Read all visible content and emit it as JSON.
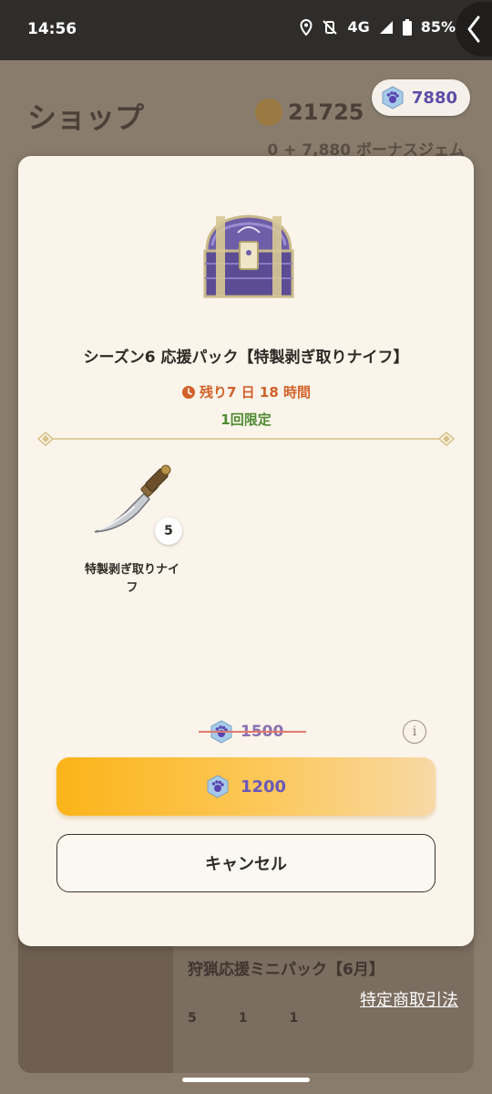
{
  "status_bar": {
    "time": "14:56",
    "network": "4G",
    "battery": "85%"
  },
  "shop": {
    "title": "ショップ",
    "coins": "21725",
    "gems": "7880",
    "bonus_gem_text": "0 + 7,880 ボーナスジェム"
  },
  "background_card": {
    "title": "狩猟応援ミニパック【6月】",
    "counts": [
      "5",
      "1",
      "1"
    ]
  },
  "legal_link": "特定商取引法",
  "modal": {
    "pack_title": "シーズン6 応援パック【特製剥ぎ取りナイフ】",
    "timer": "残り7 日 18 時間",
    "limit": "1回限定",
    "item": {
      "name": "特製剥ぎ取りナイフ",
      "quantity": "5"
    },
    "original_price": "1500",
    "price": "1200",
    "info_label": "i",
    "cancel_label": "キャンセル"
  },
  "icons": {
    "gem": "paw-gem-icon",
    "coin": "coin-icon",
    "clock": "clock-icon",
    "info": "info-icon"
  },
  "colors": {
    "timer": "#d0622a",
    "limit": "#4f8a33",
    "gem_text": "#6a58b8",
    "buy_button": "#fbb418"
  }
}
